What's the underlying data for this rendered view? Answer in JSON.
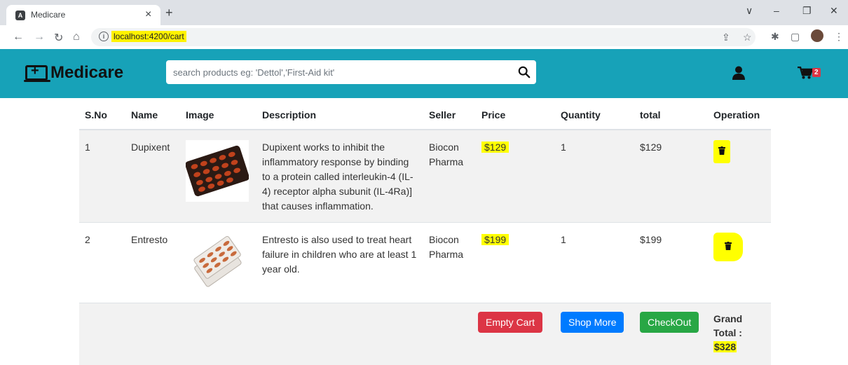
{
  "browser": {
    "tab_title": "Medicare",
    "tab_close": "×",
    "new_tab": "+",
    "url": "localhost:4200/cart",
    "window_controls": [
      "∨",
      "–",
      "❐",
      "✕"
    ]
  },
  "navbar": {
    "brand": "Medicare",
    "search_placeholder": "search products eg: 'Dettol','First-Aid kit'",
    "cart_count": "2",
    "brand_color": "#17a2b8"
  },
  "table": {
    "headers": [
      "S.No",
      "Name",
      "Image",
      "Description",
      "Seller",
      "Price",
      "Quantity",
      "total",
      "Operation"
    ],
    "rows": [
      {
        "sno": "1",
        "name": "Dupixent",
        "description": "Dupixent works to inhibit the inflammatory response by binding to a protein called interleukin-4 (IL-4) receptor alpha subunit (IL-4Ra)] that causes inflammation.",
        "seller": "Biocon Pharma",
        "price": "$129",
        "quantity": "1",
        "total": "$129"
      },
      {
        "sno": "2",
        "name": "Entresto",
        "description": "Entresto is also used to treat heart failure in children who are at least 1 year old.",
        "seller": "Biocon Pharma",
        "price": "$199",
        "quantity": "1",
        "total": "$199"
      }
    ]
  },
  "footer": {
    "empty_cart": "Empty Cart",
    "shop_more": "Shop More",
    "checkout": "CheckOut",
    "grand_total_label": "Grand Total :",
    "grand_total_value": "$328"
  }
}
